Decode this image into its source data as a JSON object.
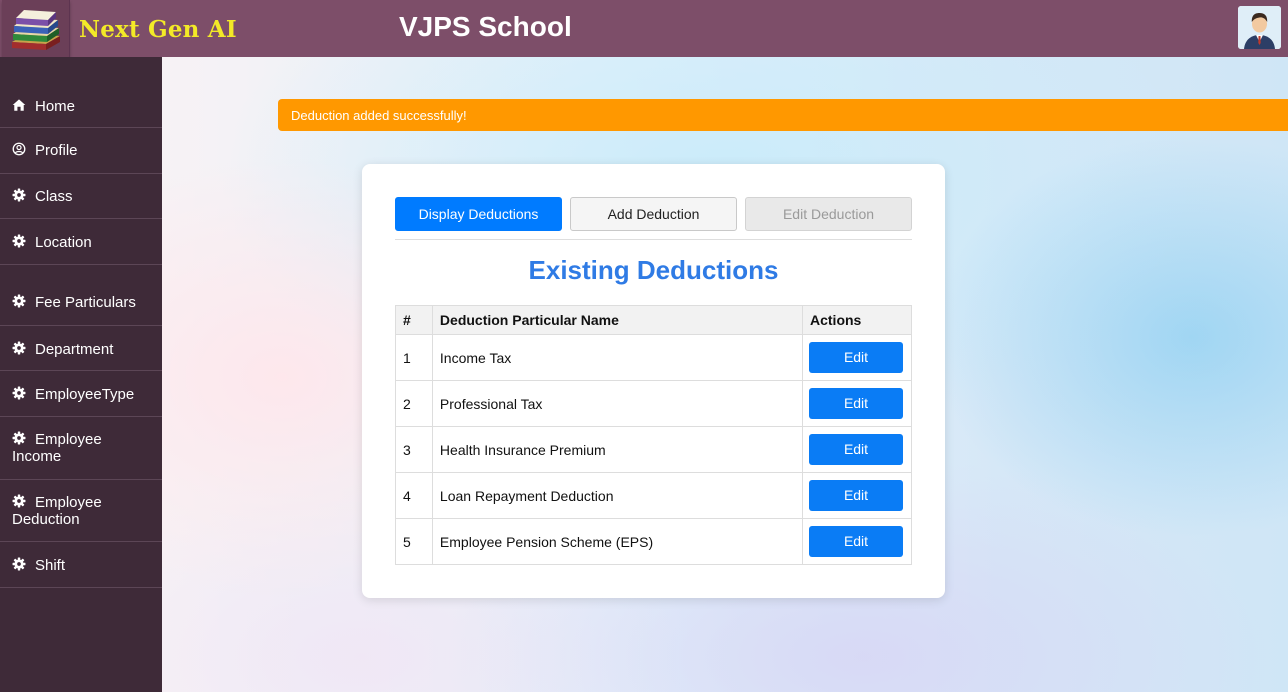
{
  "header": {
    "brand": "Next Gen AI",
    "school": "VJPS School",
    "logo_icon": "books-stack-icon",
    "avatar_icon": "user-avatar-icon",
    "bg_color": "#7d4e69",
    "brand_color": "#f3ea27"
  },
  "sidebar": {
    "items": [
      {
        "label": "Home",
        "icon": "home-icon"
      },
      {
        "label": "Profile",
        "icon": "user-circle-icon"
      },
      {
        "label": "Class",
        "icon": "gear-icon"
      },
      {
        "label": "Location",
        "icon": "gear-icon"
      },
      {
        "label": "Fee Particulars",
        "icon": "gear-icon"
      },
      {
        "label": "Department",
        "icon": "gear-icon"
      },
      {
        "label": "EmployeeType",
        "icon": "gear-icon"
      },
      {
        "label": "Employee Income",
        "line1": "Employee",
        "line2": "Income",
        "icon": "gear-icon"
      },
      {
        "label": "Employee Deduction",
        "line1": "Employee",
        "line2": "Deduction",
        "icon": "gear-icon"
      },
      {
        "label": "Shift",
        "icon": "gear-icon"
      }
    ],
    "bg_color": "#3e2a38"
  },
  "alert": {
    "text": "Deduction added successfully!",
    "color": "#ff9800"
  },
  "tabs": [
    {
      "label": "Display Deductions",
      "state": "active"
    },
    {
      "label": "Add Deduction",
      "state": "normal"
    },
    {
      "label": "Edit Deduction",
      "state": "disabled"
    }
  ],
  "section_title": "Existing Deductions",
  "table": {
    "headers": [
      "#",
      "Deduction Particular Name",
      "Actions"
    ],
    "rows": [
      {
        "num": "1",
        "name": "Income Tax",
        "action": "Edit"
      },
      {
        "num": "2",
        "name": "Professional Tax",
        "action": "Edit"
      },
      {
        "num": "3",
        "name": "Health Insurance Premium",
        "action": "Edit"
      },
      {
        "num": "4",
        "name": "Loan Repayment Deduction",
        "action": "Edit"
      },
      {
        "num": "5",
        "name": "Employee Pension Scheme (EPS)",
        "action": "Edit"
      }
    ]
  },
  "accent_color": "#007bff"
}
